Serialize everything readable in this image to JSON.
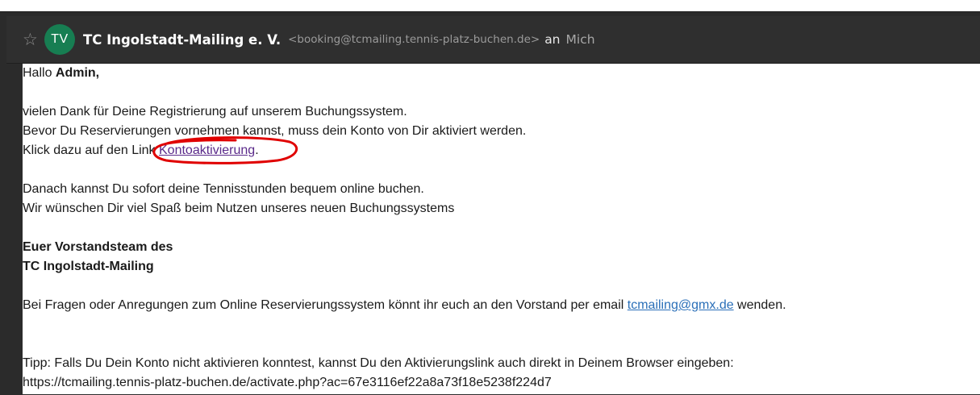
{
  "header": {
    "star_glyph": "☆",
    "avatar_initials": "TV",
    "sender_name": "TC Ingolstadt-Mailing e. V.",
    "sender_email": "<booking@tcmailing.tennis-platz-buchen.de>",
    "to_word": "an",
    "recipient": "Mich"
  },
  "body": {
    "greeting_prefix": "Hallo ",
    "greeting_name": "Admin,",
    "line1": "vielen Dank für Deine Registrierung auf unserem Buchungssystem.",
    "line2": "Bevor Du Reservierungen vornehmen kannst, muss dein Konto von Dir aktiviert werden.",
    "line3_prefix": "Klick dazu auf den Link ",
    "activation_link": "Kontoaktivierung",
    "line3_suffix": ".",
    "line4": "Danach kannst Du sofort deine Tennisstunden bequem online buchen.",
    "line5": "Wir wünschen Dir viel Spaß beim Nutzen unseres neuen Buchungssystems",
    "sign1": "Euer Vorstandsteam des",
    "sign2": "TC Ingolstadt-Mailing",
    "questions_prefix": "Bei Fragen oder Anregungen zum Online Reservierungssystem könnt ihr euch an den Vorstand per email ",
    "contact_email": "tcmailing@gmx.de",
    "questions_suffix": " wenden.",
    "tip": "Tipp: Falls Du Dein Konto nicht aktivieren konntest, kannst Du den Aktivierungslink auch direkt in Deinem Browser eingeben:",
    "activation_url": "https://tcmailing.tennis-platz-buchen.de/activate.php?ac=67e3116ef22a8a73f18e5238f224d7"
  },
  "colors": {
    "header_bg": "#2f2f2f",
    "avatar_bg": "#177e52",
    "annotation": "#e00000",
    "link_visited": "#5a2a8a",
    "link": "#2a6fb8"
  }
}
